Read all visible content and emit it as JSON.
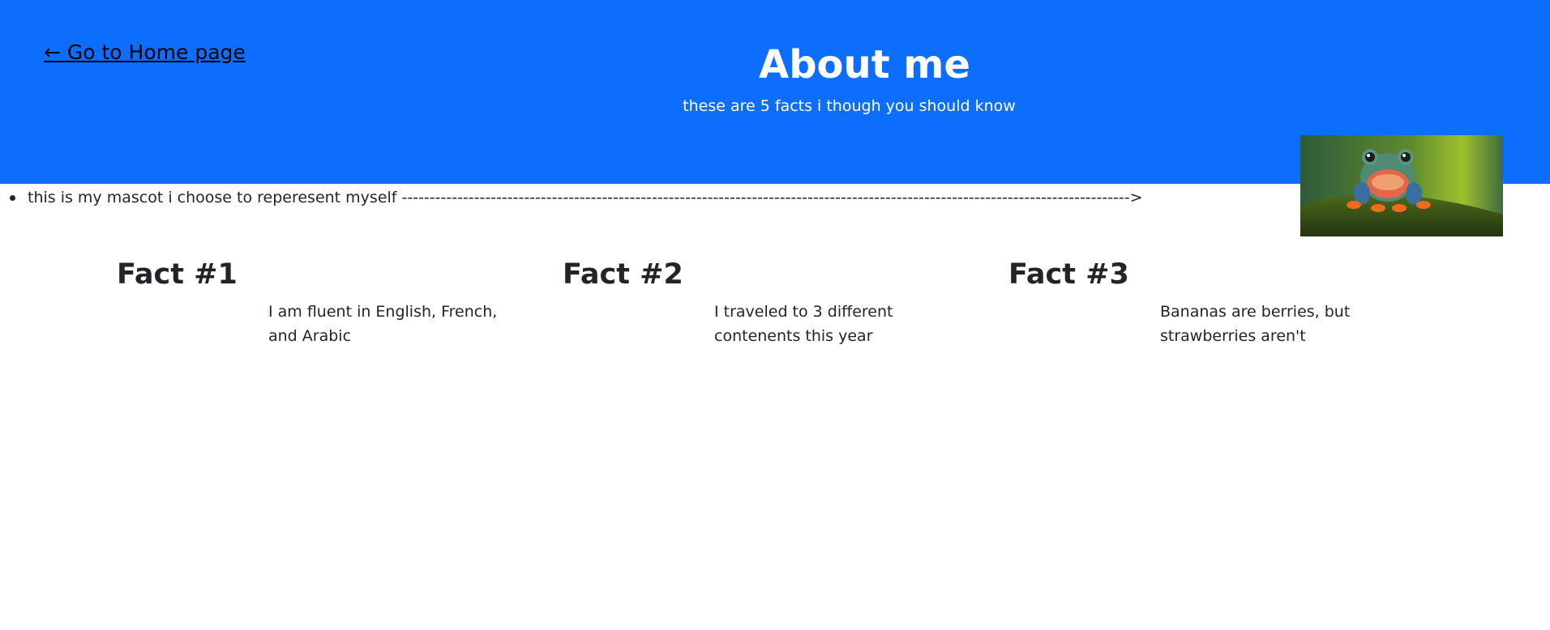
{
  "header": {
    "home_link": "← Go to Home page",
    "title": "About me",
    "subtitle": "these are 5 facts i though you should know"
  },
  "mascot": {
    "caption": "this is my mascot i choose to reperesent myself -----------------------------------------------------------------------------------------------------------------------------------> ",
    "icon": "frog-image"
  },
  "facts": [
    {
      "title": "Fact #1",
      "text": "I am fluent in English, French, and Arabic"
    },
    {
      "title": "Fact #2",
      "text": "I traveled to 3 different contenents this year"
    },
    {
      "title": "Fact #3",
      "text": "Bananas are berries, but strawberries aren't"
    }
  ],
  "colors": {
    "header_bg": "#0d6efd",
    "text": "#212529",
    "header_text": "#ffffff"
  }
}
